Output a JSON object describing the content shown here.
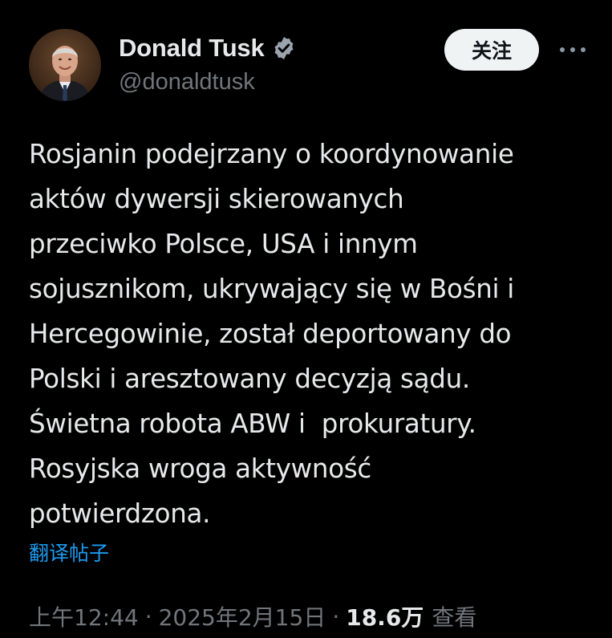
{
  "author": {
    "display_name": "Donald Tusk",
    "handle": "@donaldtusk",
    "verified": true
  },
  "actions": {
    "follow_label": "关注",
    "more_icon": "more-horizontal-icon"
  },
  "tweet": {
    "lines": [
      "Rosjanin podejrzany o koordynowanie",
      "aktów dywersji skierowanych",
      "przeciwko Polsce, USA i innym",
      "sojusznikom, ukrywający się w Bośni i",
      "Hercegowinie, został deportowany do",
      "Polski i aresztowany decyzją sądu.",
      "Świetna robota ABW i  prokuratury.",
      "Rosyjska wroga aktywność",
      "potwierdzona."
    ]
  },
  "translate_label": "翻译帖子",
  "meta": {
    "time": "上午12:44",
    "separator": "·",
    "date": "2025年2月15日",
    "views_count": "18.6万",
    "views_label": "查看"
  },
  "colors": {
    "background": "#000000",
    "text_primary": "#e7e9ea",
    "text_secondary": "#71767b",
    "accent_blue": "#1d9bf0",
    "verified_badge": "#9aa4ad",
    "follow_button_bg": "#eff3f4"
  }
}
